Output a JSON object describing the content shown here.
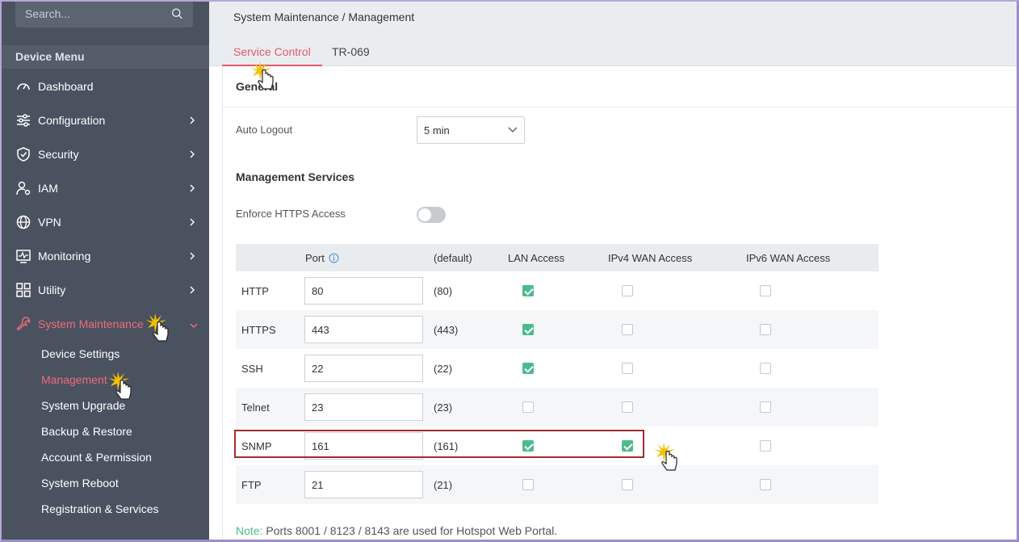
{
  "sidebar": {
    "search_placeholder": "Search...",
    "menu_title": "Device Menu",
    "items": [
      {
        "label": "Dashboard",
        "icon": "dashboard-icon"
      },
      {
        "label": "Configuration",
        "icon": "sliders-icon"
      },
      {
        "label": "Security",
        "icon": "shield-icon"
      },
      {
        "label": "IAM",
        "icon": "user-gear-icon"
      },
      {
        "label": "VPN",
        "icon": "globe-icon"
      },
      {
        "label": "Monitoring",
        "icon": "monitor-chart-icon"
      },
      {
        "label": "Utility",
        "icon": "grid-icon"
      },
      {
        "label": "System Maintenance",
        "icon": "wrench-icon"
      }
    ],
    "sub_items": [
      {
        "label": "Device Settings"
      },
      {
        "label": "Management"
      },
      {
        "label": "System Upgrade"
      },
      {
        "label": "Backup & Restore"
      },
      {
        "label": "Account & Permission"
      },
      {
        "label": "System Reboot"
      },
      {
        "label": "Registration & Services"
      }
    ]
  },
  "header": {
    "breadcrumb": "System Maintenance / Management",
    "tabs": [
      {
        "label": "Service Control"
      },
      {
        "label": "TR-069"
      }
    ]
  },
  "general": {
    "title": "General",
    "auto_logout_label": "Auto Logout",
    "auto_logout_value": "5 min"
  },
  "management": {
    "title": "Management Services",
    "enforce_https_label": "Enforce HTTPS Access",
    "enforce_https_on": false,
    "columns": {
      "port": "Port",
      "default": "(default)",
      "lan": "LAN Access",
      "ipv4": "IPv4 WAN Access",
      "ipv6": "IPv6 WAN Access"
    },
    "rows": [
      {
        "name": "HTTP",
        "port": "80",
        "default": "(80)",
        "lan": true,
        "ipv4": false,
        "ipv6": false
      },
      {
        "name": "HTTPS",
        "port": "443",
        "default": "(443)",
        "lan": true,
        "ipv4": false,
        "ipv6": false
      },
      {
        "name": "SSH",
        "port": "22",
        "default": "(22)",
        "lan": true,
        "ipv4": false,
        "ipv6": false
      },
      {
        "name": "Telnet",
        "port": "23",
        "default": "(23)",
        "lan": false,
        "ipv4": false,
        "ipv6": false
      },
      {
        "name": "SNMP",
        "port": "161",
        "default": "(161)",
        "lan": true,
        "ipv4": true,
        "ipv6": false
      },
      {
        "name": "FTP",
        "port": "21",
        "default": "(21)",
        "lan": false,
        "ipv4": false,
        "ipv6": false
      }
    ],
    "note_key": "Note:",
    "note_text": " Ports 8001 / 8123 / 8143 are used for Hotspot Web Portal."
  },
  "colors": {
    "accent": "#e5576b",
    "check": "#4cbb8c",
    "sidebar_bg": "#4a5260",
    "highlight": "#a32a2a"
  }
}
